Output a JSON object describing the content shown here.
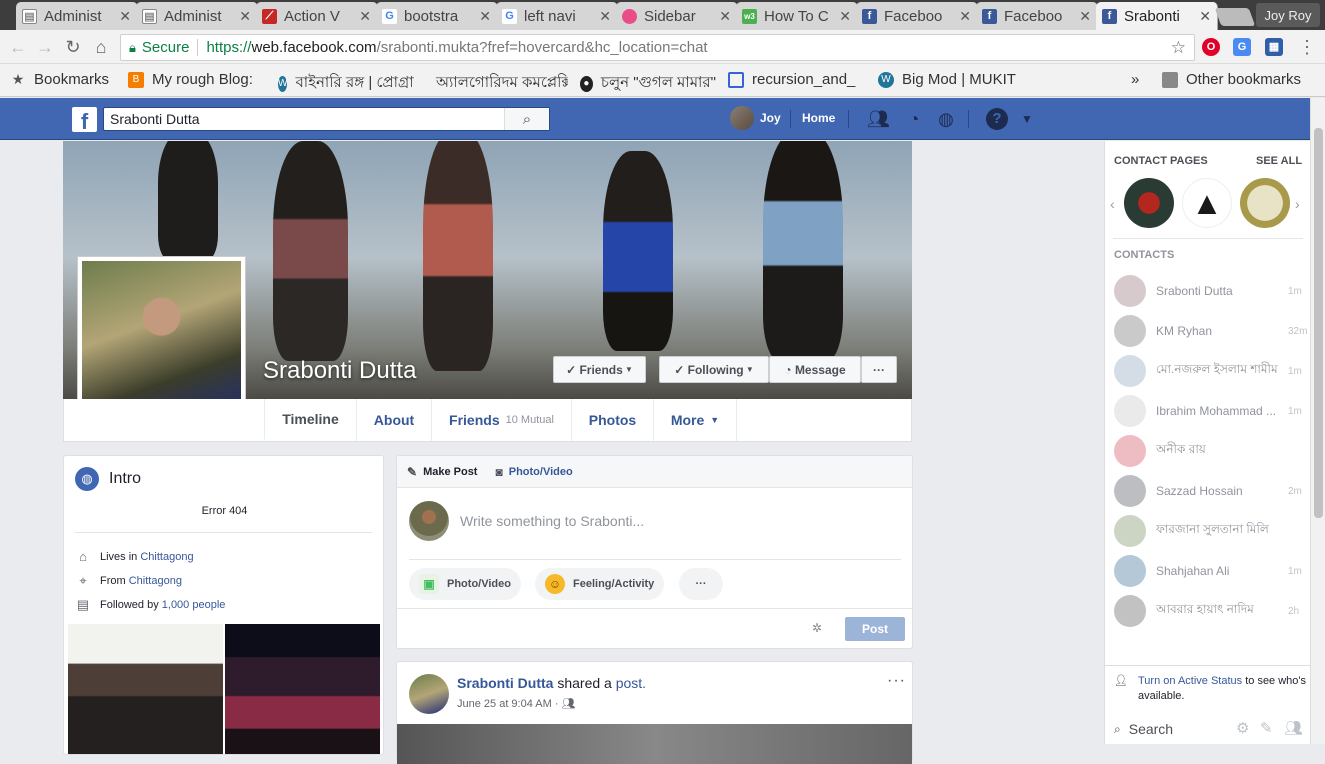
{
  "browser": {
    "tabs": [
      {
        "title": "Administ",
        "icon": "document-icon"
      },
      {
        "title": "Administ",
        "icon": "document-icon"
      },
      {
        "title": "Action V",
        "icon": "red-feather-icon"
      },
      {
        "title": "bootstra",
        "icon": "google-icon"
      },
      {
        "title": "left navi",
        "icon": "google-icon"
      },
      {
        "title": "Sidebar",
        "icon": "dribbble-icon"
      },
      {
        "title": "How To C",
        "icon": "w3schools-icon"
      },
      {
        "title": "Faceboo",
        "icon": "facebook-icon"
      },
      {
        "title": "Faceboo",
        "icon": "facebook-icon"
      },
      {
        "title": "Srabonti",
        "icon": "facebook-icon"
      }
    ],
    "profile_name": "Joy Roy",
    "secure_label": "Secure",
    "url_scheme": "https://",
    "url_host": "web.facebook.com",
    "url_rest": "/srabonti.mukta?fref=hovercard&hc_location=chat",
    "bookmarks": [
      {
        "label": "Bookmarks"
      },
      {
        "label": "My rough Blog:"
      },
      {
        "label": "বাইনারি রঙ্গ | প্রোগ্রামি"
      },
      {
        "label": "অ্যালগোরিদম কমপ্লেক্সি"
      },
      {
        "label": "চলুন \"গুগল মামার\""
      },
      {
        "label": "recursion_and_"
      },
      {
        "label": "Big Mod | MUKIT"
      }
    ],
    "overflow": "»",
    "other_bookmarks": "Other bookmarks"
  },
  "fb": {
    "search_value": "Srabonti Dutta",
    "user_name": "Joy",
    "home_label": "Home"
  },
  "profile": {
    "name": "Srabonti Dutta",
    "friends_btn": "Friends",
    "following_btn": "Following",
    "message_btn": "Message",
    "more_btn": "···",
    "tabs": {
      "timeline": "Timeline",
      "about": "About",
      "friends": "Friends",
      "friends_sub": "10 Mutual",
      "photos": "Photos",
      "more": "More"
    }
  },
  "intro": {
    "title": "Intro",
    "bio": "Error 404",
    "lives_prefix": "Lives in ",
    "lives_city": "Chittagong",
    "from_prefix": "From ",
    "from_city": "Chittagong",
    "followed_prefix": "Followed by ",
    "followed_count": "1,000 people"
  },
  "composer": {
    "make_post": "Make Post",
    "photo_video_tab": "Photo/Video",
    "placeholder": "Write something to Srabonti...",
    "photo_video_pill": "Photo/Video",
    "feeling_pill": "Feeling/Activity",
    "more_pill": "···",
    "post_button": "Post"
  },
  "post": {
    "author": "Srabonti Dutta",
    "action": " shared a ",
    "link": "post.",
    "time": "June 25 at 9:04 AM · ",
    "more": "···"
  },
  "chat": {
    "contact_pages": "CONTACT PAGES",
    "see_all": "SEE ALL",
    "contacts_header": "CONTACTS",
    "contacts": [
      {
        "name": "Srabonti Dutta",
        "time": "1m"
      },
      {
        "name": "KM Ryhan",
        "time": "32m"
      },
      {
        "name": "মো.নজরুল ইসলাম শামীম",
        "time": "1m"
      },
      {
        "name": "Ibrahim Mohammad ...",
        "time": "1m"
      },
      {
        "name": "অনীক রায়",
        "time": ""
      },
      {
        "name": "Sazzad Hossain",
        "time": "2m"
      },
      {
        "name": "ফারজানা সুলতানা মিলি",
        "time": ""
      },
      {
        "name": "Shahjahan Ali",
        "time": "1m"
      },
      {
        "name": "আবরার হায়াৎ নাদিম",
        "time": "2h"
      }
    ],
    "active_link": "Turn on Active Status",
    "active_rest": " to see who's available.",
    "search_label": "Search"
  },
  "colors": {
    "fb_blue": "#4267b2",
    "link_blue": "#365899",
    "secure_green": "#0b8043"
  }
}
